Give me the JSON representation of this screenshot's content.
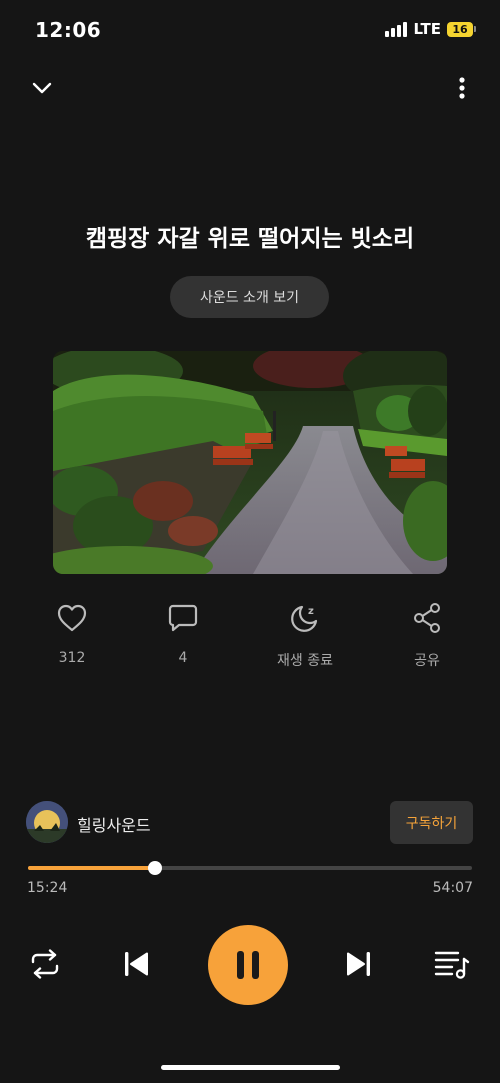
{
  "status_bar": {
    "time": "12:06",
    "network": "LTE",
    "battery": "16",
    "battery_color": "#f5d430"
  },
  "header": {
    "collapse_icon": "chevron-down-icon",
    "more_icon": "more-vertical-icon"
  },
  "track": {
    "title": "캠핑장 자갈 위로 떨어지는 빗소리",
    "intro_label": "사운드 소개 보기",
    "artwork": "park-path-with-benches-in-rain"
  },
  "actions": {
    "like": {
      "icon": "heart-icon",
      "label": "312"
    },
    "comment": {
      "icon": "comment-icon",
      "label": "4"
    },
    "sleep_timer": {
      "icon": "moon-icon",
      "label": "재생 종료"
    },
    "share": {
      "icon": "share-icon",
      "label": "공유"
    }
  },
  "channel": {
    "name": "힐링사운드",
    "subscribe_label": "구독하기"
  },
  "player": {
    "current_time": "15:24",
    "total_time": "54:07",
    "progress": 0.285,
    "accent_color": "#f7a23a",
    "controls": [
      "repeat-icon",
      "previous-icon",
      "pause-icon",
      "next-icon",
      "playlist-icon"
    ]
  }
}
